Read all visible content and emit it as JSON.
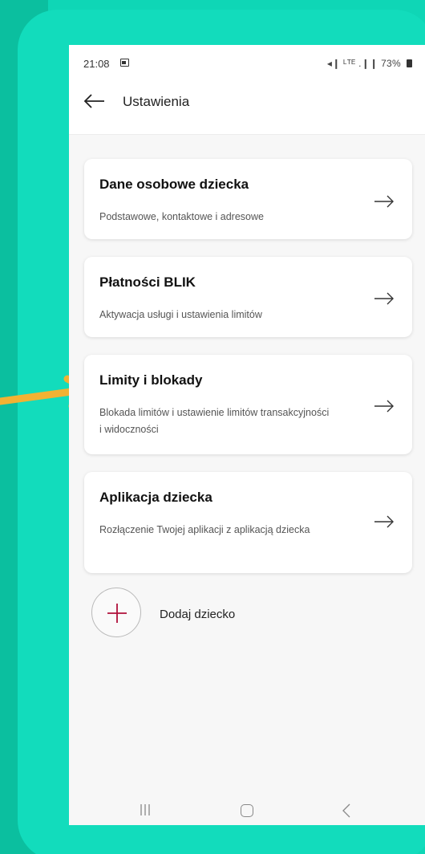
{
  "statusbar": {
    "time": "21:08",
    "right_indicators": "◂❙ ᴸᵀᴱ .❙❙ 73%"
  },
  "appbar": {
    "title": "Ustawienia"
  },
  "cards": [
    {
      "title": "Dane osobowe dziecka",
      "description": "Podstawowe, kontaktowe i adresowe"
    },
    {
      "title": "Płatności BLIK",
      "description": "Aktywacja usługi i ustawienia limitów"
    },
    {
      "title": "Limity i blokady",
      "description": "Blokada limitów i ustawienie limitów transakcyjności i widoczności"
    },
    {
      "title": "Aplikacja dziecka",
      "description": "Rozłączenie Twojej aplikacji z aplikacją dziecka"
    }
  ],
  "add_child": {
    "label": "Dodaj dziecko"
  },
  "colors": {
    "background": "#10c7a8",
    "panel": "#12dcbc",
    "pointer_arrow": "#f2b233",
    "add_plus": "#b0103a"
  },
  "icons": {
    "back": "arrow-left",
    "card_arrow": "arrow-right",
    "add": "plus",
    "pointer": "arrow-right",
    "nav_recent": "three-bars",
    "nav_home": "rounded-square",
    "nav_back": "chevron-left"
  }
}
